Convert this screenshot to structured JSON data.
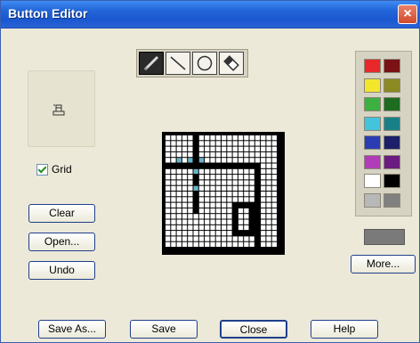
{
  "window": {
    "title": "Button Editor",
    "close_symbol": "×"
  },
  "preview": {
    "icon": "button-preview-icon"
  },
  "grid_checkbox": {
    "label": "Grid",
    "checked": true
  },
  "buttons": {
    "clear": "Clear",
    "open": "Open...",
    "undo": "Undo",
    "more": "More...",
    "save_as": "Save As...",
    "save": "Save",
    "close": "Close",
    "help": "Help"
  },
  "tools": [
    {
      "name": "pencil",
      "icon": "pencil-icon",
      "active": true
    },
    {
      "name": "line",
      "icon": "line-icon",
      "active": false
    },
    {
      "name": "circle",
      "icon": "circle-icon",
      "active": false
    },
    {
      "name": "eraser",
      "icon": "eraser-icon",
      "active": false
    }
  ],
  "palette": {
    "left_column": [
      "#e8282a",
      "#f4e62c",
      "#3cb040",
      "#44c4dc",
      "#2a3cb4",
      "#b03cb8",
      "#ffffff",
      "#b8b8b8"
    ],
    "right_column": [
      "#7a1216",
      "#8c8a22",
      "#1e6c20",
      "#1a8088",
      "#1c2068",
      "#6a1c80",
      "#000000",
      "#808080"
    ],
    "selected_color": "#7a7a7a"
  }
}
